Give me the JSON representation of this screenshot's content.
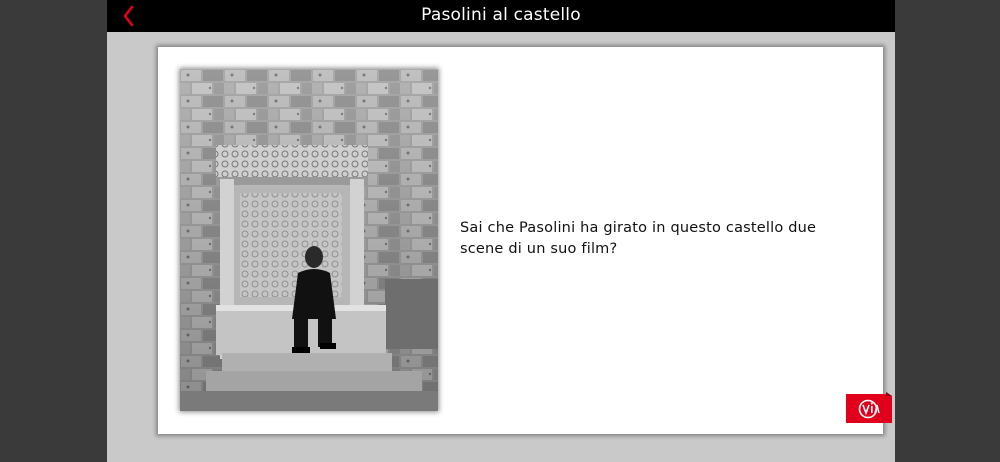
{
  "header": {
    "title": "Pasolini al castello",
    "back_icon": "chevron-left-icon"
  },
  "content": {
    "question": "Sai che Pasolini ha girato in questo castello due scene di un suo film?"
  },
  "colors": {
    "accent": "#e0001b",
    "header_bg": "#000000",
    "frame_bg": "#c9c9c9",
    "outer_bg": "#3a3a3a",
    "card_bg": "#ffffff"
  },
  "badge": {
    "icon": "app-logo-icon"
  }
}
